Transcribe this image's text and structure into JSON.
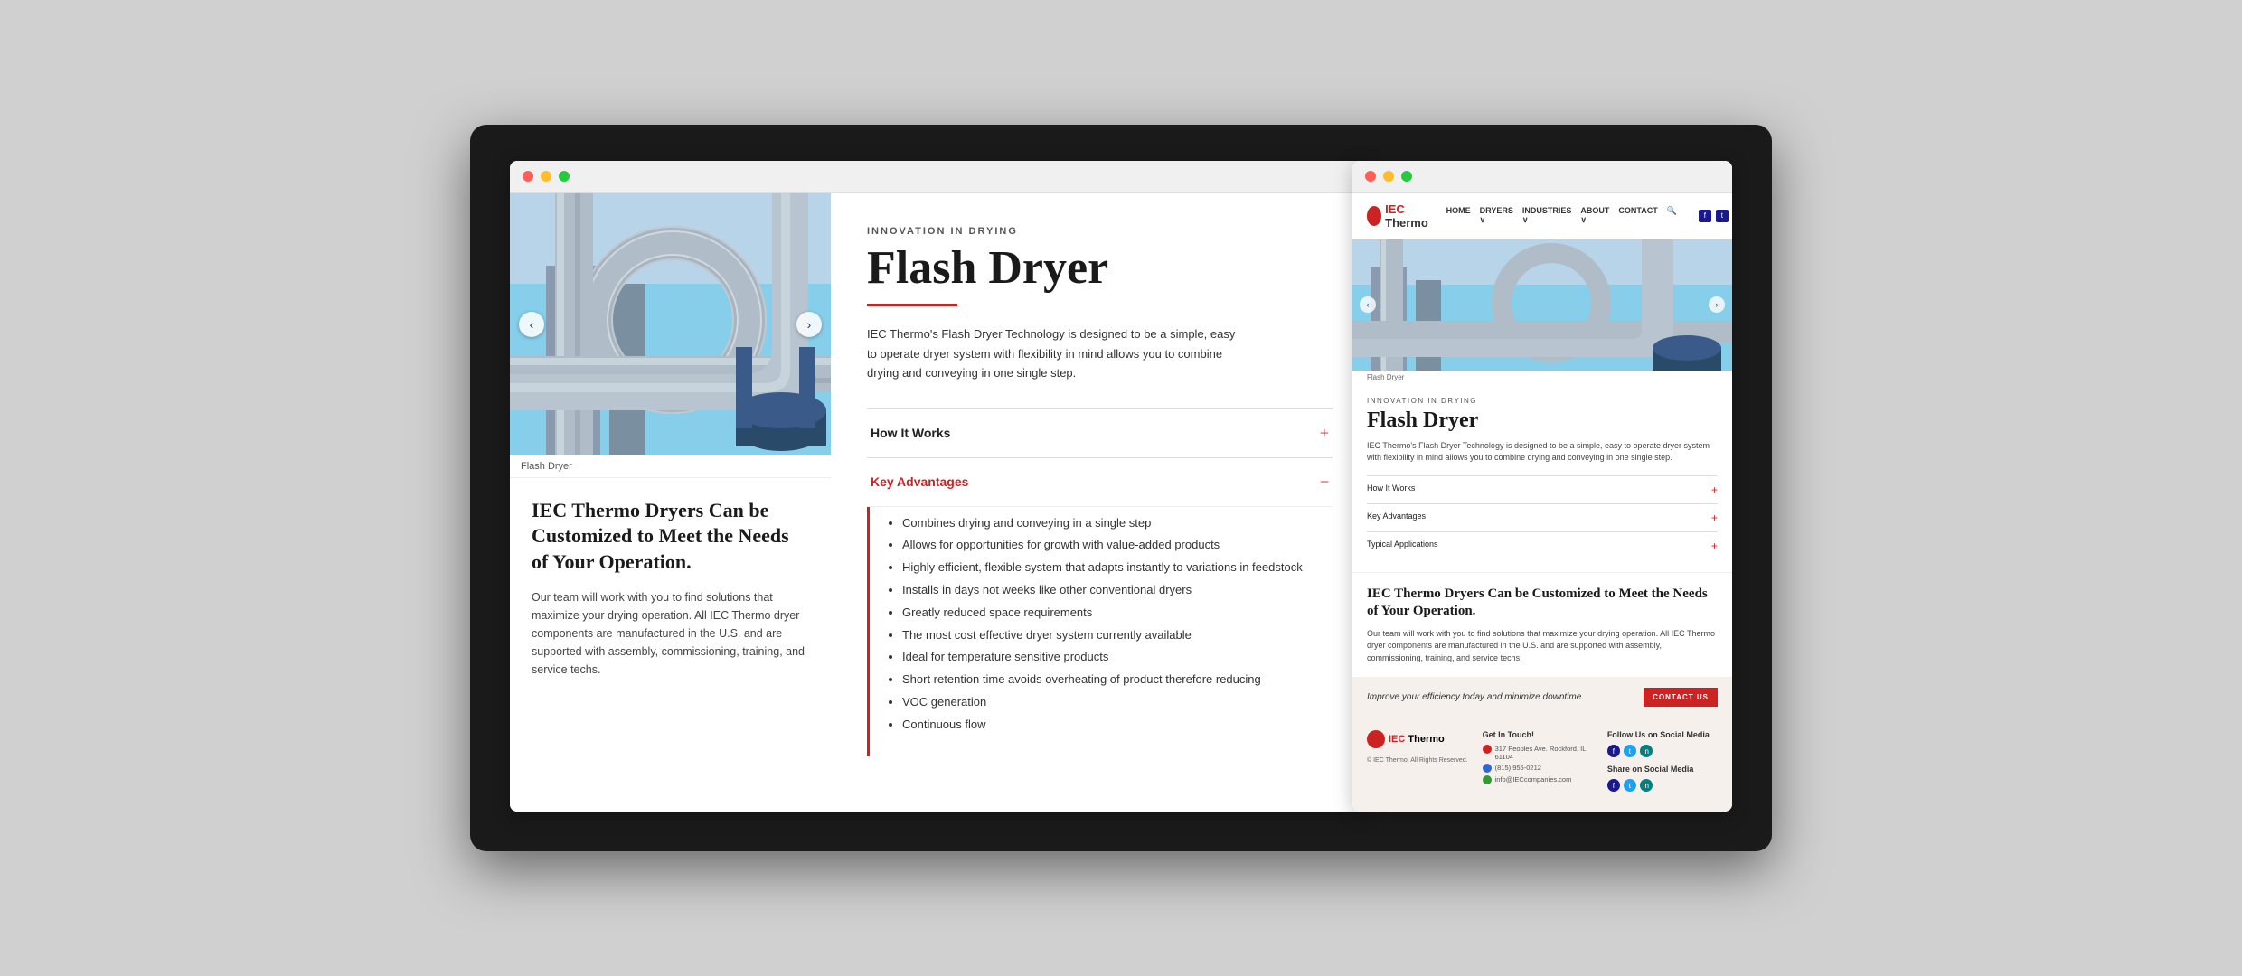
{
  "browser_left": {
    "image_caption": "Flash Dryer",
    "heading": "IEC Thermo Dryers Can be Customized to Meet the Needs of Your Operation.",
    "body_text": "Our team will work with you to find solutions that maximize your drying operation. All IEC Thermo dryer components are manufactured in the U.S. and are supported with assembly, commissioning, training, and service techs.",
    "innovation_label": "INNOVATION IN DRYING",
    "flash_dryer_title": "Flash Dryer",
    "description": "IEC Thermo's Flash Dryer Technology is designed to be a simple, easy to operate dryer system with flexibility in mind allows you to combine drying and conveying in one single step.",
    "how_it_works_label": "How It Works",
    "key_advantages_label": "Key Advantages",
    "key_advantages_list": [
      "Combines drying and conveying in a single step",
      "Allows for opportunities for growth with value-added products",
      "Highly efficient, flexible system that adapts instantly to variations in feedstock",
      "Installs in days not weeks like other conventional dryers",
      "Greatly reduced space requirements",
      "The most cost effective dryer system currently available",
      "Ideal for temperature sensitive products",
      "Short retention time avoids overheating of product therefore reducing",
      "VOC generation",
      "Continuous flow"
    ]
  },
  "browser_right": {
    "logo_iec": "IEC",
    "logo_thermo": " Thermo",
    "nav_links": [
      "HOME",
      "DRYERS ∨",
      "INDUSTRIES ∨",
      "ABOUT ∨",
      "CONTACT"
    ],
    "innovation_label": "INNOVATION IN DRYING",
    "flash_dryer_title": "Flash Dryer",
    "description": "IEC Thermo's Flash Dryer Technology is designed to be a simple, easy to operate dryer system with flexibility in mind allows you to combine drying and conveying in one single step.",
    "how_it_works_label": "How It Works",
    "key_advantages_label": "Key Advantages",
    "typical_applications_label": "Typical Applications",
    "image_caption": "Flash Dryer",
    "customize_heading": "IEC Thermo Dryers Can be Customized to Meet the Needs of Your Operation.",
    "customize_body": "Our team will work with you to find solutions that maximize your drying operation. All IEC Thermo dryer components are manufactured in the U.S. and are supported with assembly, commissioning, training, and service techs.",
    "cta_text": "Improve your efficiency today and minimize downtime.",
    "cta_button": "CONTACT US",
    "footer": {
      "get_in_touch": "Get In Touch!",
      "address": "317 Peoples Ave. Rockford, IL 61104",
      "phone": "(815) 955-0212",
      "email": "info@IECcompanies.com",
      "follow_label": "Follow Us on Social Media",
      "share_label": "Share on Social Media",
      "copyright": "© IEC Thermo. All Rights Reserved."
    }
  },
  "icons": {
    "chevron_left": "‹",
    "chevron_right": "›",
    "plus": "+",
    "minus": "−",
    "facebook": "f",
    "twitter": "t",
    "linkedin": "in",
    "search": "🔍",
    "location": "📍",
    "phone": "📞",
    "mail": "✉"
  }
}
